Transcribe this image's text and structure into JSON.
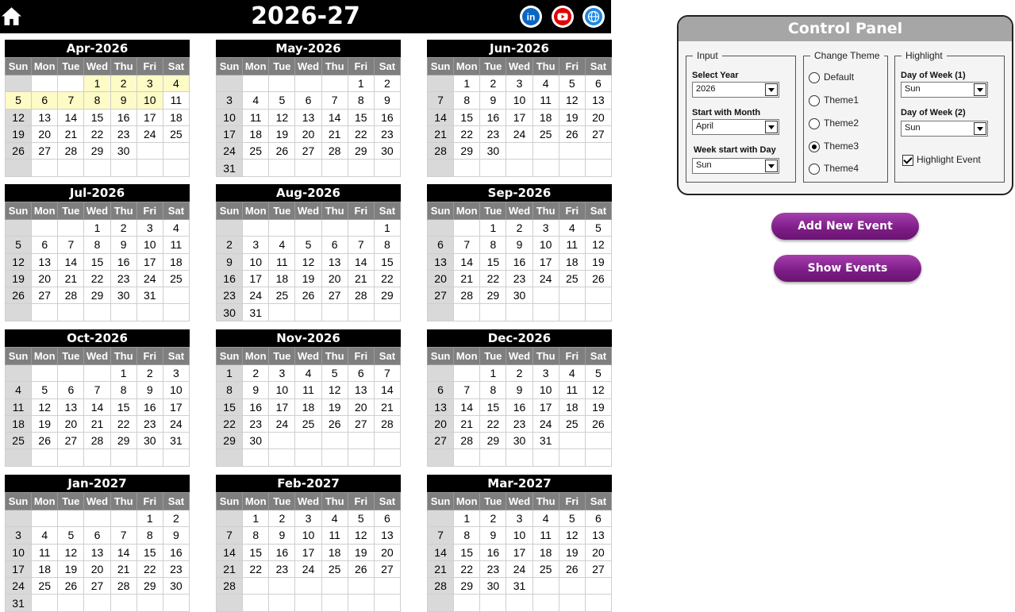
{
  "header": {
    "title": "2026-27",
    "icons": [
      "home-icon",
      "linkedin-icon",
      "youtube-icon",
      "globe-icon"
    ]
  },
  "weekdays": [
    "Sun",
    "Mon",
    "Tue",
    "Wed",
    "Thu",
    "Fri",
    "Sat"
  ],
  "months": [
    {
      "name": "Apr-2026",
      "start": 3,
      "days": 30,
      "highlight": [
        1,
        2,
        3,
        4,
        5,
        6,
        7,
        8,
        9,
        10
      ]
    },
    {
      "name": "May-2026",
      "start": 5,
      "days": 31,
      "highlight": []
    },
    {
      "name": "Jun-2026",
      "start": 1,
      "days": 30,
      "highlight": []
    },
    {
      "name": "Jul-2026",
      "start": 3,
      "days": 31,
      "highlight": []
    },
    {
      "name": "Aug-2026",
      "start": 6,
      "days": 31,
      "highlight": []
    },
    {
      "name": "Sep-2026",
      "start": 2,
      "days": 30,
      "highlight": []
    },
    {
      "name": "Oct-2026",
      "start": 4,
      "days": 31,
      "highlight": []
    },
    {
      "name": "Nov-2026",
      "start": 0,
      "days": 30,
      "highlight": []
    },
    {
      "name": "Dec-2026",
      "start": 2,
      "days": 31,
      "highlight": []
    },
    {
      "name": "Jan-2027",
      "start": 5,
      "days": 31,
      "highlight": []
    },
    {
      "name": "Feb-2027",
      "start": 1,
      "days": 28,
      "highlight": []
    },
    {
      "name": "Mar-2027",
      "start": 1,
      "days": 31,
      "highlight": []
    }
  ],
  "control_panel": {
    "title": "Control Panel",
    "input": {
      "label": "Input",
      "year_label": "Select Year",
      "year_value": "2026",
      "month_label": "Start with Month",
      "month_value": "April",
      "weekstart_label": "Week start with Day",
      "weekstart_value": "Sun"
    },
    "theme": {
      "label": "Change Theme",
      "options": [
        "Default",
        "Theme1",
        "Theme2",
        "Theme3",
        "Theme4"
      ],
      "selected": "Theme3"
    },
    "highlight": {
      "label": "Highlight",
      "dow1_label": "Day of Week (1)",
      "dow1_value": "Sun",
      "dow2_label": "Day of Week (2)",
      "dow2_value": "Sun",
      "event_label": "Highlight Event",
      "event_checked": true
    }
  },
  "buttons": {
    "add_event": "Add New Event",
    "show_events": "Show Events"
  },
  "colors": {
    "header_bg": "#000000",
    "weekday_bg": "#7f7f7f",
    "sunday_bg": "#d9d9d9",
    "highlight_bg": "#fdfbc6",
    "button_purple": "#8b2494",
    "linkedin": "#0a66c2",
    "youtube": "#e00000",
    "globe": "#1e88e5"
  }
}
